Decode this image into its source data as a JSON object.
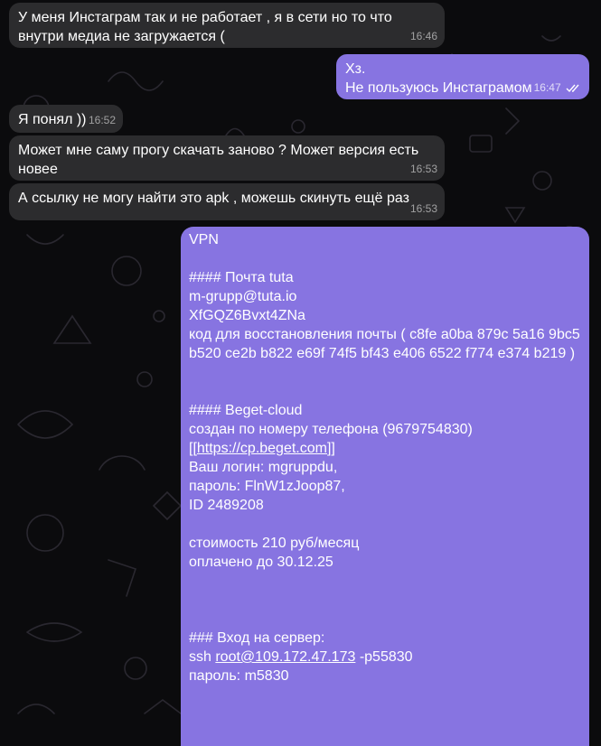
{
  "messages": [
    {
      "text": "У меня Инстаграм так и не работает , я в сети но то что внутри медиа не загружается (",
      "time": "16:46"
    },
    {
      "text": "Хз.\nНе пользуюсь Инстаграмом",
      "time": "16:47"
    },
    {
      "text": "Я понял ))",
      "time": "16:52"
    },
    {
      "text": "Может мне саму прогу скачать заново ? Может версия есть новее",
      "time": "16:53"
    },
    {
      "text": "А ссылку не могу найти это apk , можешь скинуть ещё раз",
      "time": "16:53"
    }
  ],
  "note": {
    "title": "VPN",
    "mail_heading": "#### Почта tuta",
    "mail_login": "m-grupp@tuta.io",
    "mail_pass": "XfGQZ6Bvxt4ZNa",
    "mail_recovery": "код для восстановления почты ( c8fe a0ba 879c 5a16 9bc5 b520 ce2b b822 e69f 74f5 bf43 e406 6522 f774 e374 b219 )",
    "beget_heading": "#### Beget-cloud",
    "beget_phone": "создан по номеру телефона (9679754830)",
    "beget_link_open": "[[",
    "beget_link": "https://cp.beget.com",
    "beget_link_close": "]]",
    "beget_login": "Ваш логин: mgruppdu,",
    "beget_pass": "пароль: FlnW1zJoop87,",
    "beget_id": "ID 2489208",
    "cost": "стоимость 210 руб/месяц",
    "paid_until": "оплачено до 30.12.25",
    "server_heading": "### Вход на сервер:",
    "ssh_prefix": "ssh ",
    "ssh_link": "root@109.172.47.173",
    "ssh_suffix": " -p55830",
    "server_pass": "пароль: m5830"
  },
  "colors": {
    "background": "#0b0b0d",
    "incoming_bubble": "#2c2c2e",
    "outgoing_bubble": "#8774e1"
  }
}
